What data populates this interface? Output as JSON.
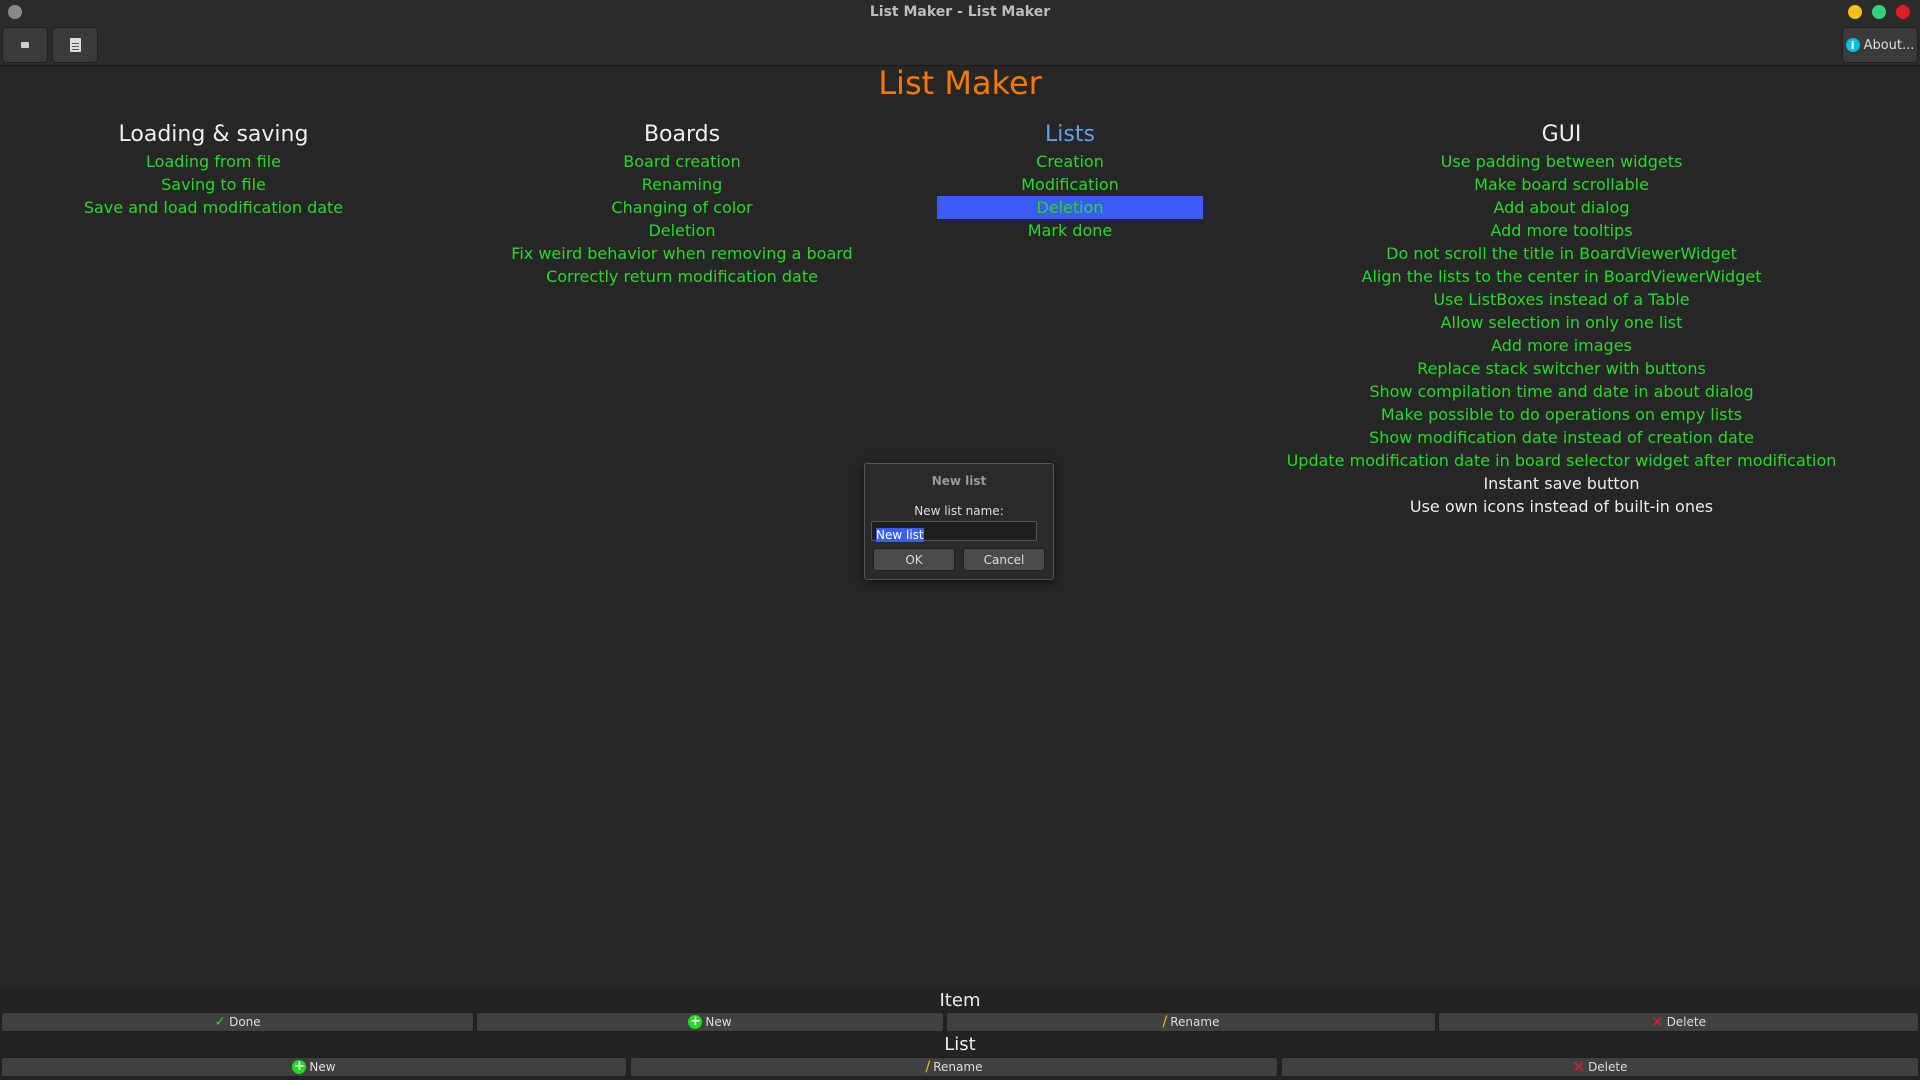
{
  "window": {
    "title": "List Maker - List Maker"
  },
  "toolbar": {
    "about_label": "About..."
  },
  "board": {
    "title": "List Maker"
  },
  "columns": [
    {
      "header": "Loading & saving",
      "items": [
        {
          "text": "Loading from file",
          "done": false
        },
        {
          "text": "Saving to file",
          "done": false
        },
        {
          "text": "Save and load modification date",
          "done": false
        }
      ]
    },
    {
      "header": "Boards",
      "items": [
        {
          "text": "Board creation",
          "done": false
        },
        {
          "text": "Renaming",
          "done": false
        },
        {
          "text": "Changing of color",
          "done": false
        },
        {
          "text": "Deletion",
          "done": false
        },
        {
          "text": "Fix weird behavior when removing a board",
          "done": false
        },
        {
          "text": "Correctly return modification date",
          "done": false
        }
      ]
    },
    {
      "header": "Lists",
      "active": true,
      "items": [
        {
          "text": "Creation",
          "done": false
        },
        {
          "text": "Modification",
          "done": false
        },
        {
          "text": "Deletion",
          "done": false,
          "selected": true
        },
        {
          "text": "Mark done",
          "done": false
        }
      ]
    },
    {
      "header": "GUI",
      "items": [
        {
          "text": "Use padding between widgets",
          "done": false
        },
        {
          "text": "Make board scrollable",
          "done": false
        },
        {
          "text": "Add about dialog",
          "done": false
        },
        {
          "text": "Add more tooltips",
          "done": false
        },
        {
          "text": "Do not scroll the title in BoardViewerWidget",
          "done": false
        },
        {
          "text": "Align the lists to the center in BoardViewerWidget",
          "done": false
        },
        {
          "text": "Use ListBoxes instead of a Table",
          "done": false
        },
        {
          "text": "Allow selection in only one list",
          "done": false
        },
        {
          "text": "Add more images",
          "done": false
        },
        {
          "text": "Replace stack switcher with buttons",
          "done": false
        },
        {
          "text": "Show compilation time and date in about dialog",
          "done": false
        },
        {
          "text": "Make possible to do operations on empy lists",
          "done": false
        },
        {
          "text": "Show modification date instead of creation date",
          "done": false
        },
        {
          "text": "Update modification date in board selector widget after modification",
          "done": false
        },
        {
          "text": "Instant save button",
          "done": true
        },
        {
          "text": "Use own icons instead of built-in ones",
          "done": true
        }
      ]
    }
  ],
  "dialog": {
    "title": "New list",
    "label": "New list name:",
    "input_value": "New list",
    "ok_label": "OK",
    "cancel_label": "Cancel"
  },
  "item_actions": {
    "label": "Item",
    "done": "Done",
    "new": "New",
    "rename": "Rename",
    "delete": "Delete"
  },
  "list_actions": {
    "label": "List",
    "new": "New",
    "rename": "Rename",
    "delete": "Delete"
  },
  "colors": {
    "title": "#f57900",
    "item_pending": "#26d926",
    "item_done": "#ececec",
    "selection": "#3b5df5",
    "active_header": "#62a0ea"
  }
}
